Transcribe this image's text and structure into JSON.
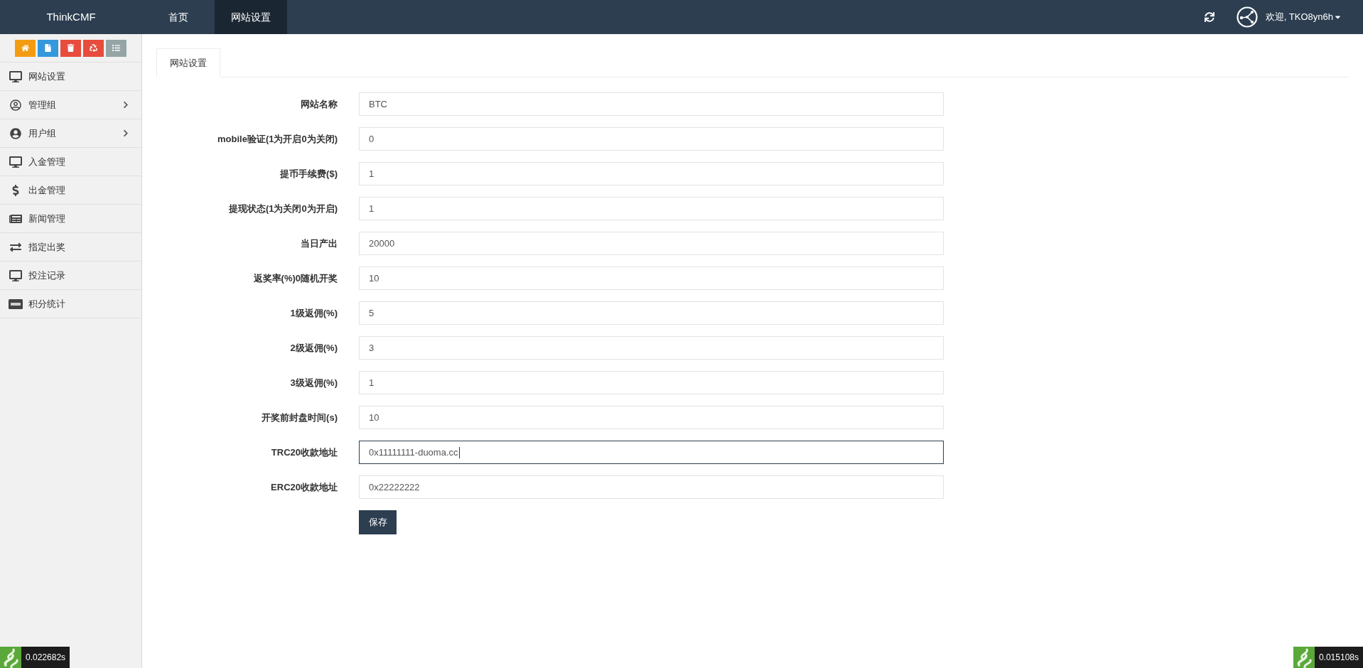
{
  "topbar": {
    "brand": "ThinkCMF",
    "nav": [
      {
        "label": "首页",
        "selected": false
      },
      {
        "label": "网站设置",
        "selected": true
      }
    ],
    "user": {
      "greeting": "欢迎, TKO8yn6h"
    }
  },
  "sidebar": {
    "items": [
      {
        "label": "网站设置",
        "has_submenu": false
      },
      {
        "label": "管理组",
        "has_submenu": true
      },
      {
        "label": "用户组",
        "has_submenu": true
      },
      {
        "label": "入金管理",
        "has_submenu": false
      },
      {
        "label": "出金管理",
        "has_submenu": false
      },
      {
        "label": "新闻管理",
        "has_submenu": false
      },
      {
        "label": "指定出奖",
        "has_submenu": false
      },
      {
        "label": "投注记录",
        "has_submenu": false
      },
      {
        "label": "积分统计",
        "has_submenu": false
      }
    ]
  },
  "tabs": [
    {
      "label": "网站设置",
      "selected": true
    }
  ],
  "form": {
    "fields": [
      {
        "label": "网站名称",
        "value": "BTC",
        "focused": false
      },
      {
        "label": "mobile验证(1为开启0为关闭)",
        "value": "0",
        "focused": false
      },
      {
        "label": "提币手续费($)",
        "value": "1",
        "focused": false
      },
      {
        "label": "提现状态(1为关闭0为开启)",
        "value": "1",
        "focused": false
      },
      {
        "label": "当日产出",
        "value": "20000",
        "focused": false
      },
      {
        "label": "返奖率(%)0随机开奖",
        "value": "10",
        "focused": false
      },
      {
        "label": "1级返佣(%)",
        "value": "5",
        "focused": false
      },
      {
        "label": "2级返佣(%)",
        "value": "3",
        "focused": false
      },
      {
        "label": "3级返佣(%)",
        "value": "1",
        "focused": false
      },
      {
        "label": "开奖前封盘时间(s)",
        "value": "10",
        "focused": false
      },
      {
        "label": "TRC20收款地址",
        "value": "0x11111111-duoma.cc",
        "focused": true
      },
      {
        "label": "ERC20收款地址",
        "value": "0x22222222",
        "focused": false
      }
    ],
    "submit": "保存"
  },
  "debug": {
    "left": "0.022682s",
    "right": "0.015108s"
  }
}
